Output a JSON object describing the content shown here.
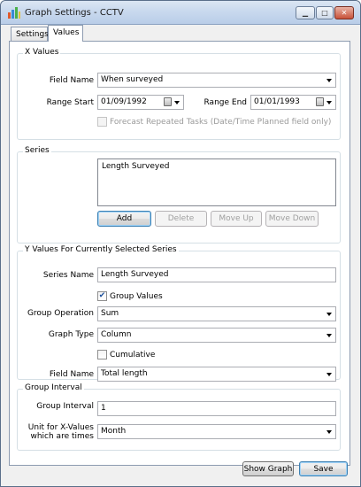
{
  "window": {
    "title": "Graph Settings - CCTV"
  },
  "tabs": [
    {
      "label": "Settings"
    },
    {
      "label": "Values"
    }
  ],
  "x_values": {
    "title": "X Values",
    "field_name_label": "Field Name",
    "field_name_value": "When surveyed",
    "range_start_label": "Range Start",
    "range_start_value": "01/09/1992",
    "range_end_label": "Range End",
    "range_end_value": "01/01/1993",
    "forecast_label": "Forecast Repeated Tasks (Date/Time Planned field only)"
  },
  "series": {
    "title": "Series",
    "items": [
      "Length Surveyed"
    ],
    "add_label": "Add",
    "delete_label": "Delete",
    "move_up_label": "Move Up",
    "move_down_label": "Move Down"
  },
  "y_values": {
    "title": "Y Values For Currently Selected Series",
    "series_name_label": "Series Name",
    "series_name_value": "Length Surveyed",
    "group_values_label": "Group Values",
    "group_operation_label": "Group Operation",
    "group_operation_value": "Sum",
    "graph_type_label": "Graph Type",
    "graph_type_value": "Column",
    "cumulative_label": "Cumulative",
    "field_name_label": "Field Name",
    "field_name_value": "Total length"
  },
  "group_interval": {
    "title": "Group Interval",
    "interval_label": "Group Interval",
    "interval_value": "1",
    "unit_label_line1": "Unit for X-Values",
    "unit_label_line2": "which are times",
    "unit_value": "Month"
  },
  "footer": {
    "show_graph_label": "Show Graph",
    "save_label": "Save"
  },
  "colors": {
    "accent": "#3c7fb1",
    "titlebar": "#c9d9ee",
    "checkmark": "#1b4f9c"
  }
}
